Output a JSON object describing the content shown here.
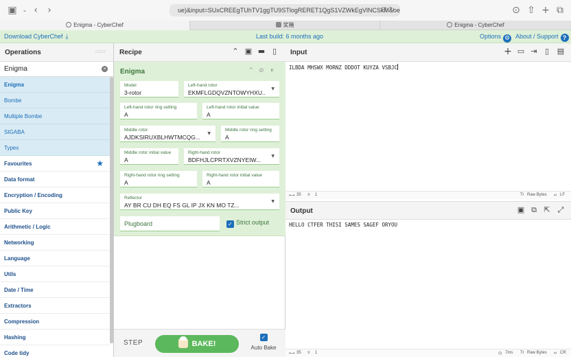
{
  "browser": {
    "url": "ue)&input=SUxCREEgTUhTV1ggTU9STlogRERET1QgS1VZWkEgVlNCSkM&oeol=CR",
    "tabs": [
      {
        "label": "Enigma - CyberChef"
      },
      {
        "label": "奖赌"
      },
      {
        "label": "Enigma - CyberChef"
      }
    ]
  },
  "banner": {
    "download": "Download CyberChef",
    "last_build": "Last build: 6 months ago",
    "options": "Options",
    "about": "About / Support"
  },
  "operations": {
    "title": "Operations",
    "search_value": "Enigma",
    "results": [
      "Enigma",
      "Bombe",
      "Multiple Bombe",
      "SIGABA",
      "Typex"
    ],
    "categories": [
      "Favourites",
      "Data format",
      "Encryption / Encoding",
      "Public Key",
      "Arithmetic / Logic",
      "Networking",
      "Language",
      "Utils",
      "Date / Time",
      "Extractors",
      "Compression",
      "Hashing",
      "Code tidy"
    ]
  },
  "recipe": {
    "title": "Recipe",
    "operation": {
      "name": "Enigma",
      "model": {
        "label": "Model",
        "value": "3-rotor"
      },
      "left_rotor": {
        "label": "Left-hand rotor",
        "value": "EKMFLGDQVZNTOWYHXU..."
      },
      "left_ring": {
        "label": "Left-hand rotor ring setting",
        "value": "A"
      },
      "left_initial": {
        "label": "Left-hand rotor initial value",
        "value": "A"
      },
      "middle_rotor": {
        "label": "Middle rotor",
        "value": "AJDKSIRUXBLHWTMCQG..."
      },
      "middle_ring": {
        "label": "Middle rotor ring setting",
        "value": "A"
      },
      "middle_initial": {
        "label": "Middle rotor initial value",
        "value": "A"
      },
      "right_rotor": {
        "label": "Right-hand rotor",
        "value": "BDFHJLCPRTXVZNYEIW..."
      },
      "right_ring": {
        "label": "Right-hand rotor ring setting",
        "value": "A"
      },
      "right_initial": {
        "label": "Right-hand rotor initial value",
        "value": "A"
      },
      "reflector": {
        "label": "Reflector",
        "value": "AY BR CU DH EQ FS GL IP JX KN MO TZ..."
      },
      "plugboard": {
        "placeholder": "Plugboard"
      },
      "strict_output": {
        "label": "Strict output",
        "checked": true
      }
    },
    "step": "STEP",
    "bake": "BAKE!",
    "auto_bake": "Auto Bake"
  },
  "input": {
    "title": "Input",
    "text": "ILBDA MHSWX MORNZ DDDOT KUYZA VSBJC",
    "status": {
      "length": "35",
      "lines": "1",
      "raw_bytes": "Raw Bytes",
      "eol": "LF"
    }
  },
  "output": {
    "title": "Output",
    "text": "HELLO CTFER THISI SAMES SAGEF ORYOU",
    "status": {
      "length": "35",
      "lines": "1",
      "time": "7ms",
      "raw_bytes": "Raw Bytes",
      "eol": "CR"
    }
  }
}
